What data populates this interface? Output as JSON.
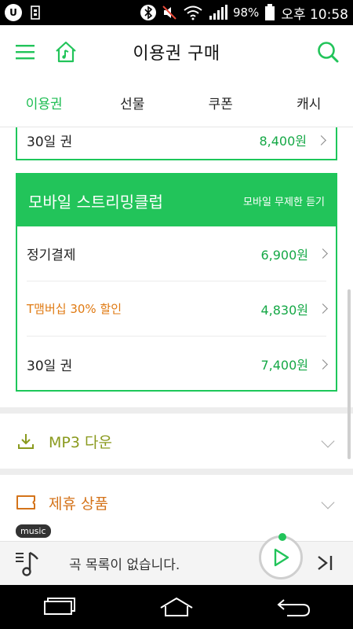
{
  "status_bar": {
    "battery": "98%",
    "time": "오후 10:58",
    "left_icons": [
      "u-app-icon",
      "usb-icon"
    ],
    "right_icons": [
      "bluetooth-icon",
      "mute-icon",
      "wifi-icon",
      "signal-icon",
      "battery-icon"
    ]
  },
  "header": {
    "title": "이용권 구매",
    "icons": [
      "menu-icon",
      "home-music-icon",
      "search-icon"
    ]
  },
  "tabs": [
    {
      "label": "이용권",
      "active": true
    },
    {
      "label": "선물",
      "active": false
    },
    {
      "label": "쿠폰",
      "active": false
    },
    {
      "label": "캐시",
      "active": false
    }
  ],
  "top_card": {
    "row": {
      "label": "30일 권",
      "price": "8,400원"
    }
  },
  "club_card": {
    "title": "모바일 스트리밍클럽",
    "subtitle": "모바일 무제한 듣기",
    "rows": [
      {
        "label": "정기결제",
        "price": "6,900원",
        "promo": false
      },
      {
        "label": "T맴버십 30% 할인",
        "price": "4,830원",
        "promo": true
      },
      {
        "label": "30일 권",
        "price": "7,400원",
        "promo": false
      }
    ]
  },
  "sections": [
    {
      "title": "MP3 다운",
      "icon": "download-icon",
      "color": "#8a9a1e"
    },
    {
      "title": "제휴 상품",
      "icon": "ticket-icon",
      "color": "#d4731a"
    }
  ],
  "player": {
    "badge": "music",
    "text": "곡 목록이 없습니다."
  },
  "colors": {
    "accent": "#1dbd52",
    "promo": "#e07a12"
  }
}
